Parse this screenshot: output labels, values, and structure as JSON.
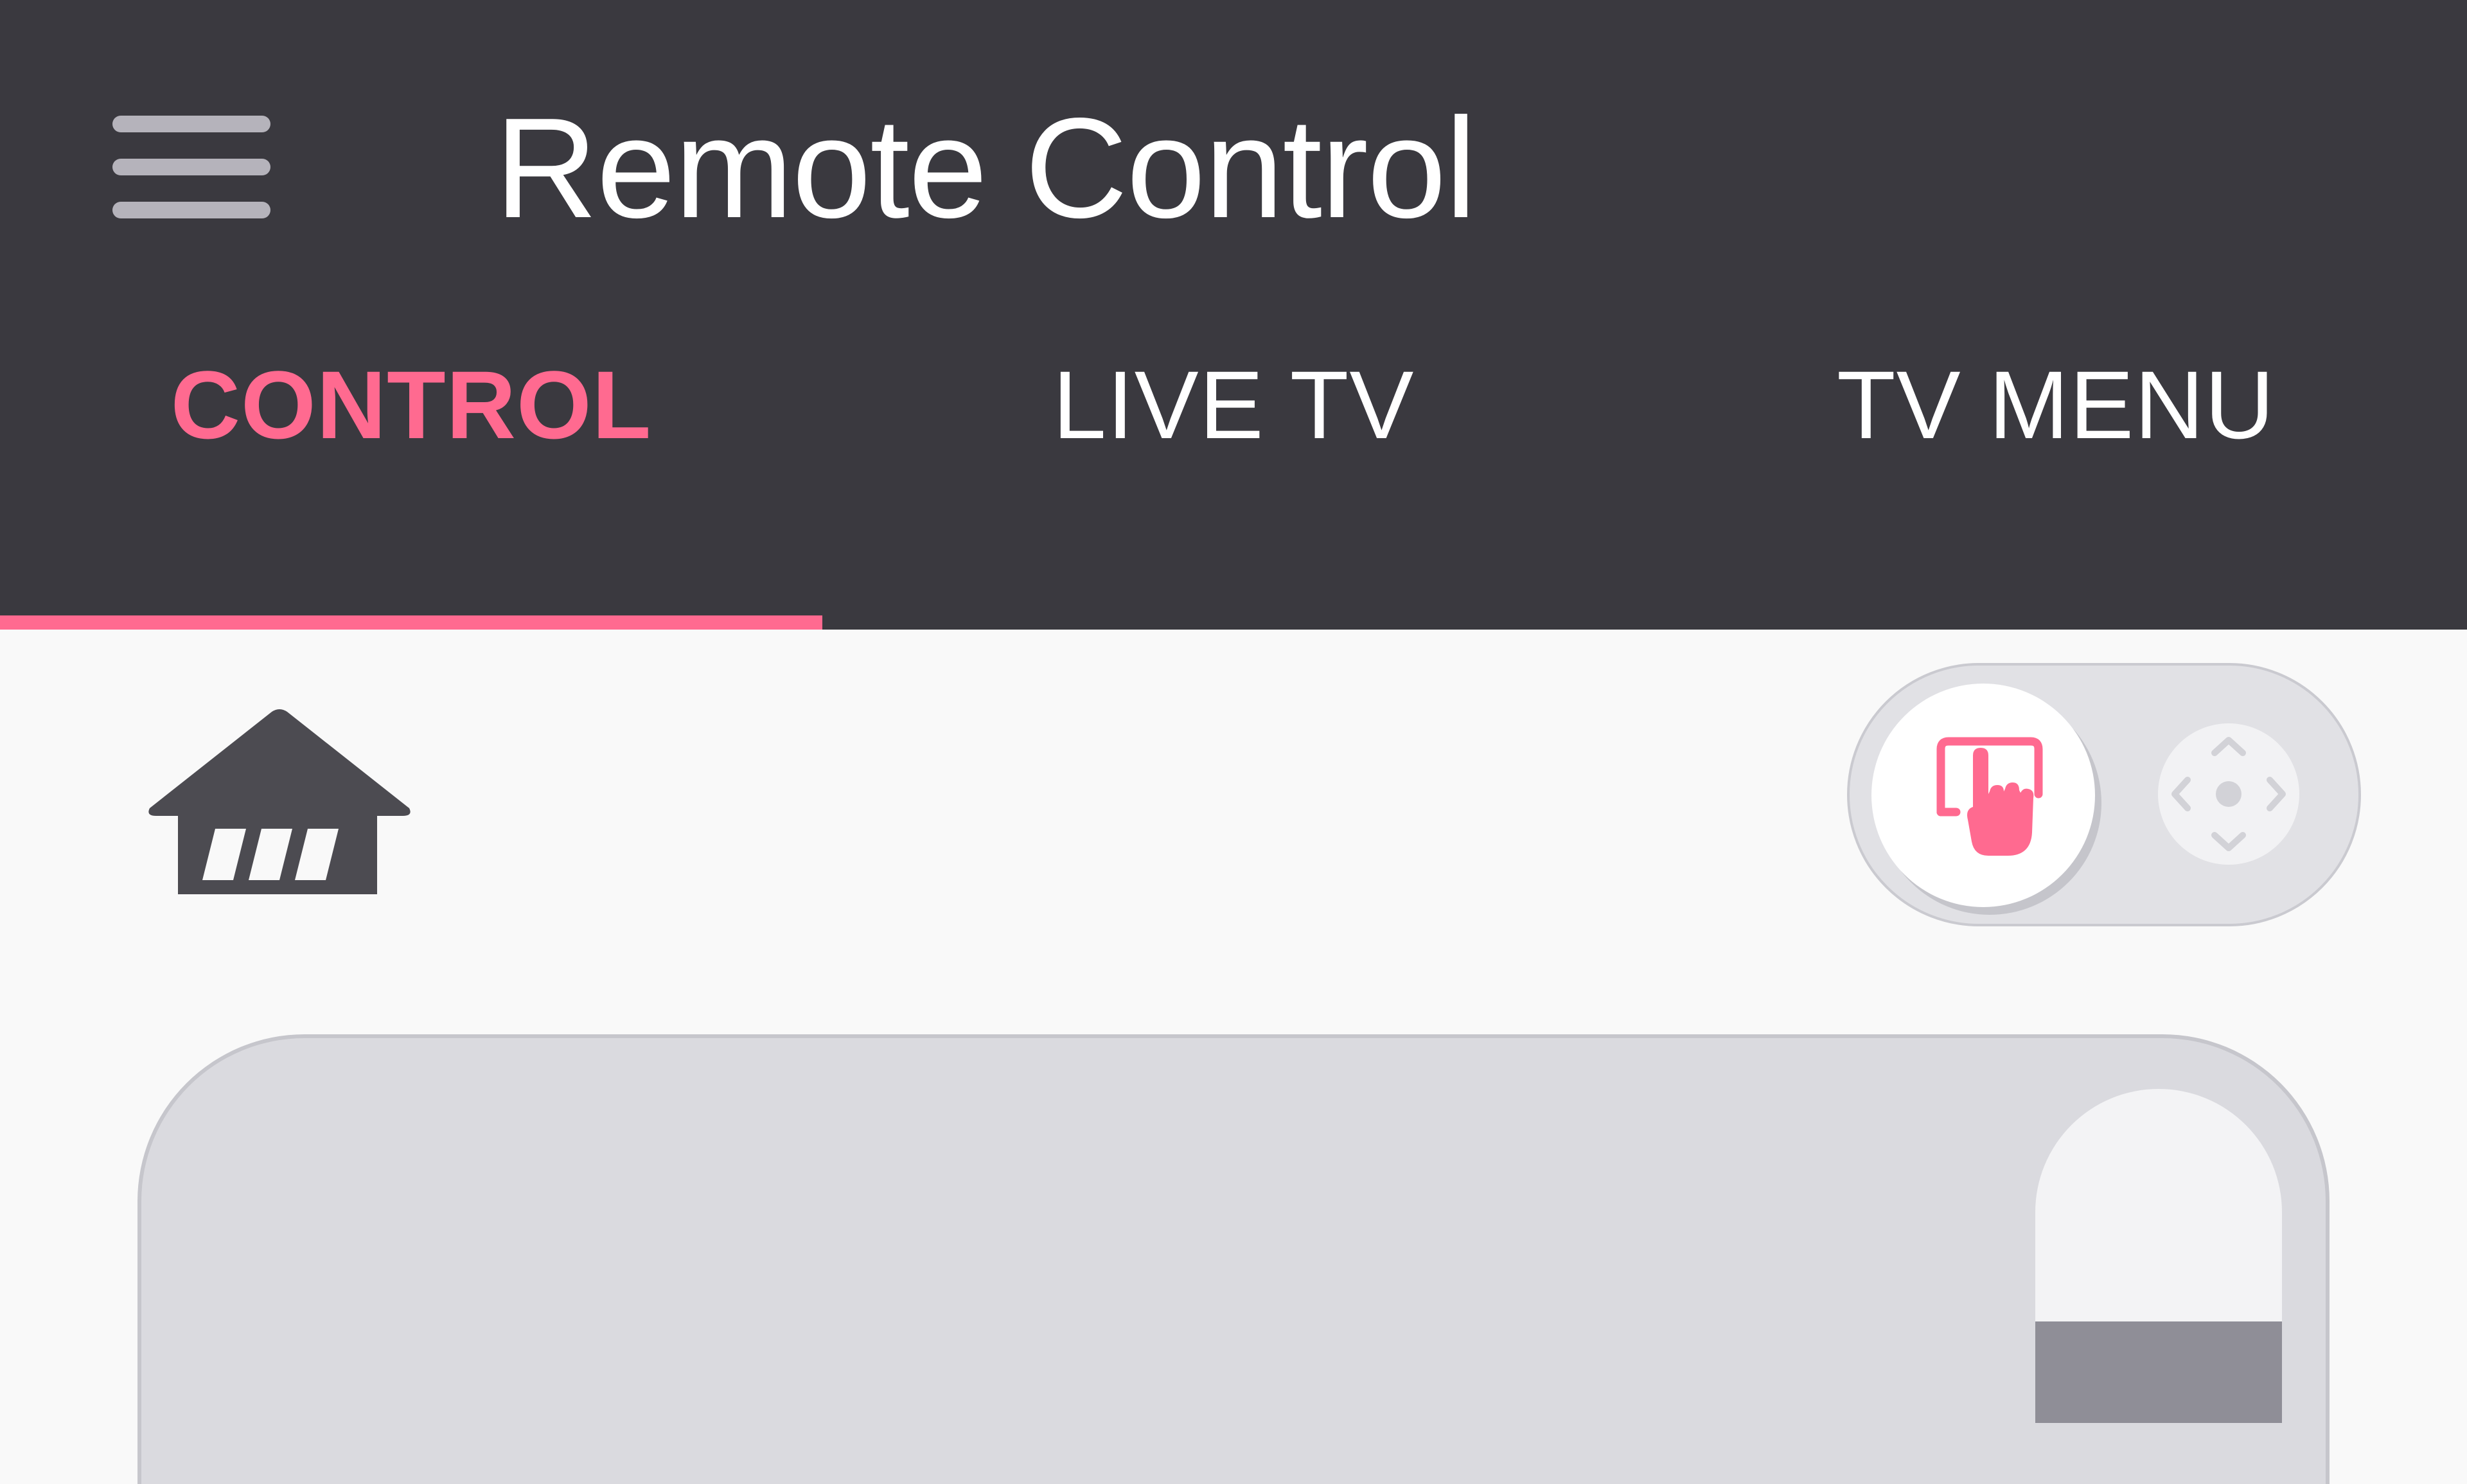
{
  "header": {
    "title": "Remote Control",
    "menu_icon": "hamburger-menu-icon"
  },
  "tabs": [
    {
      "label": "CONTROL",
      "active": true
    },
    {
      "label": "LIVE TV",
      "active": false
    },
    {
      "label": "TV MENU",
      "active": false
    }
  ],
  "home": {
    "icon": "home-icon"
  },
  "mode_toggle": {
    "selected": "touch",
    "options": [
      "touch-pointer-icon",
      "arrow-keys-icon"
    ]
  },
  "colors": {
    "accent": "#ff6a90",
    "appbar": "#3a393f",
    "background": "#f9f9f9",
    "touchpad": "#dadadf"
  }
}
